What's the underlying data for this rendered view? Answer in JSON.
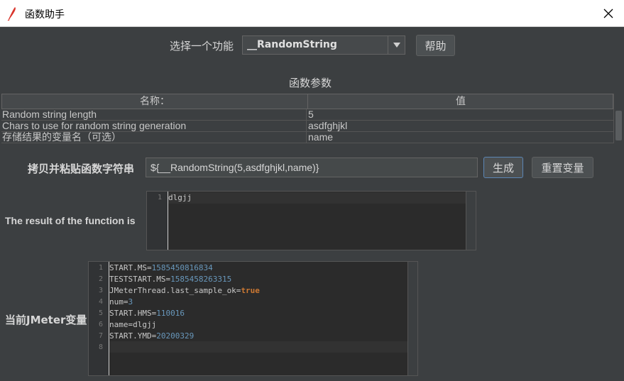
{
  "window": {
    "title": "函数助手"
  },
  "header": {
    "select_label": "选择一个功能",
    "function_selected": "__RandomString",
    "help_label": "帮助"
  },
  "params": {
    "section_title": "函数参数",
    "columns": [
      "名称：",
      "值"
    ],
    "rows": [
      {
        "name": "Random string length",
        "value": "5"
      },
      {
        "name": "Chars to use for random string generation",
        "value": "asdfghjkl"
      },
      {
        "name": "存储结果的变量名（可选）",
        "value": "name"
      }
    ]
  },
  "generate": {
    "label": "拷贝并粘贴函数字符串",
    "value": "${__RandomString(5,asdfghjkl,name)}",
    "generate_label": "生成",
    "reset_label": "重置变量"
  },
  "result": {
    "label": "The result of the function is",
    "lines": [
      "1"
    ],
    "text": "dlgjj"
  },
  "variables": {
    "label": "当前JMeter变量",
    "line_numbers": [
      "1",
      "2",
      "3",
      "4",
      "5",
      "6",
      "7",
      "8"
    ],
    "lines": [
      {
        "key": "START.MS=",
        "value": "1585450816834",
        "kind": "num"
      },
      {
        "key": "TESTSTART.MS=",
        "value": "1585458263315",
        "kind": "num"
      },
      {
        "key": "JMeterThread.last_sample_ok=",
        "value": "true",
        "kind": "kw"
      },
      {
        "key": "num=",
        "value": "3",
        "kind": "num"
      },
      {
        "key": "START.HMS=",
        "value": "110016",
        "kind": "num"
      },
      {
        "key": "name=dlgjj",
        "value": "",
        "kind": "plain"
      },
      {
        "key": "START.YMD=",
        "value": "20200329",
        "kind": "num"
      }
    ]
  },
  "colors": {
    "background": "#3c3f41",
    "number": "#6897bb",
    "keyword": "#cc7832"
  }
}
